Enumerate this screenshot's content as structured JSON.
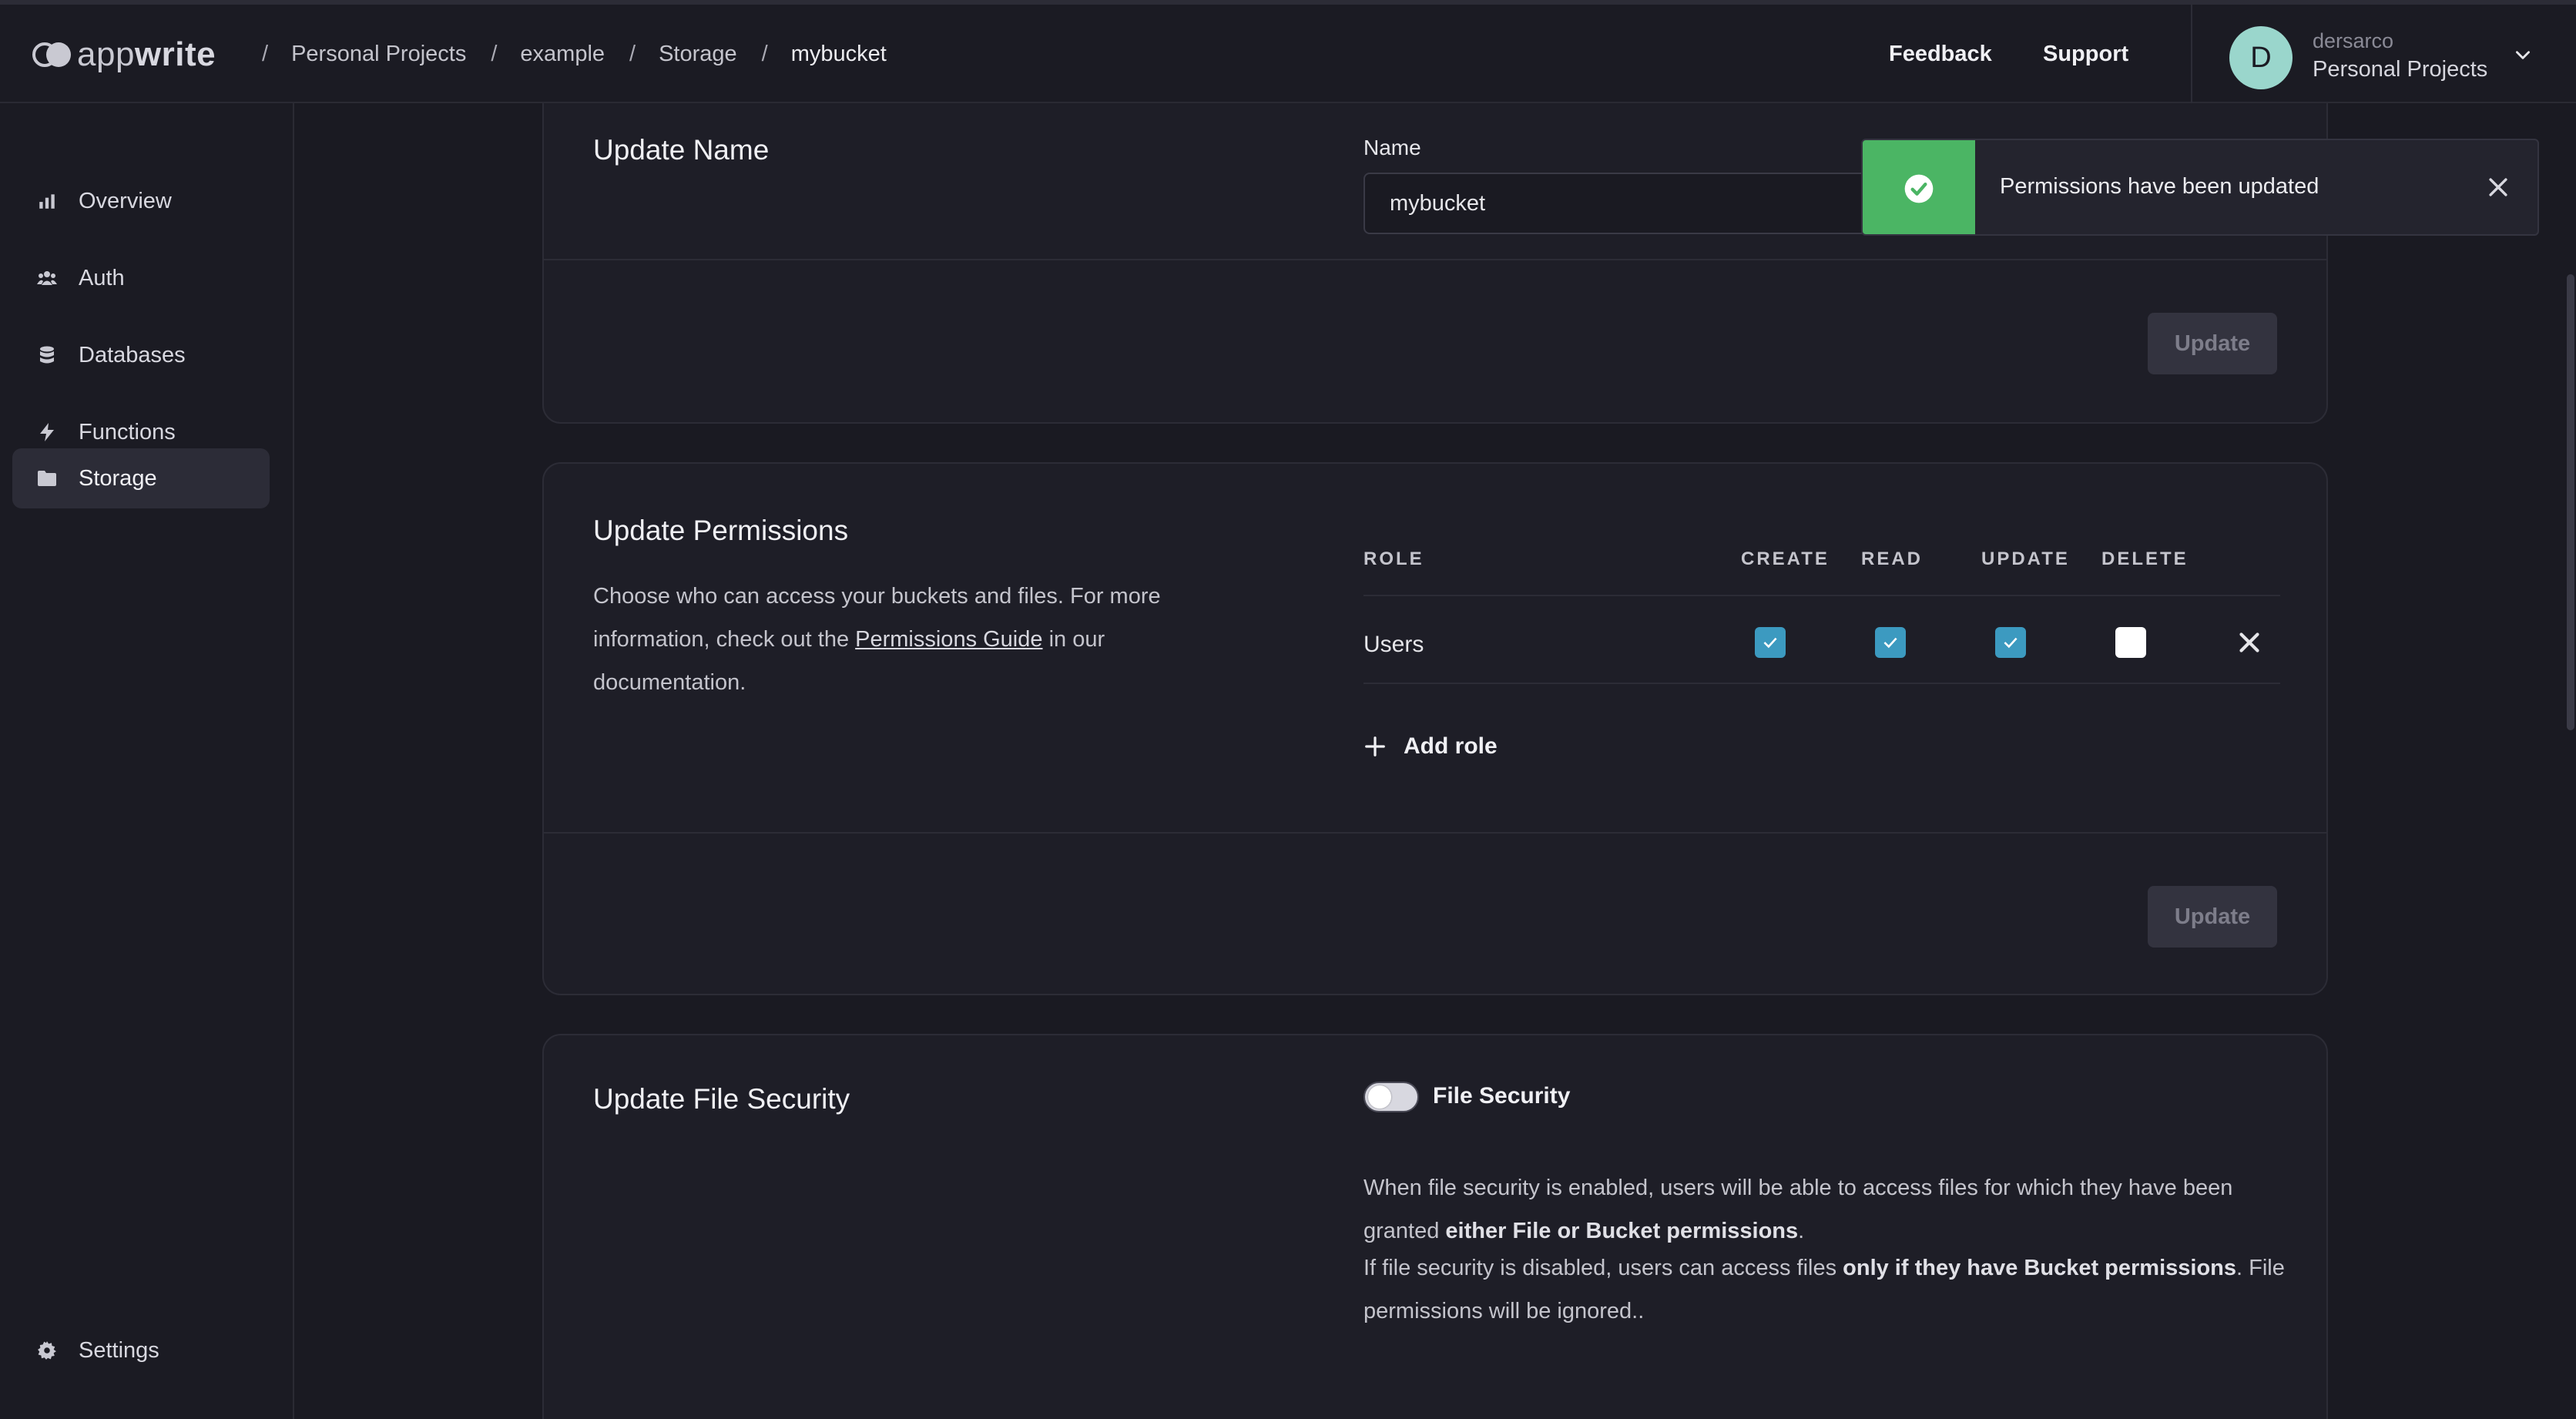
{
  "app": {
    "logo_text_light": "app",
    "logo_text_bold": "write"
  },
  "breadcrumb": [
    "Personal Projects",
    "example",
    "Storage",
    "mybucket"
  ],
  "breadcrumb_sep": "/",
  "header": {
    "feedback_label": "Feedback",
    "support_label": "Support",
    "avatar_initial": "D",
    "username": "dersarco",
    "organization": "Personal Projects"
  },
  "sidebar": {
    "items": [
      {
        "label": "Overview",
        "icon": "chart-icon"
      },
      {
        "label": "Auth",
        "icon": "users-icon"
      },
      {
        "label": "Databases",
        "icon": "database-icon"
      },
      {
        "label": "Functions",
        "icon": "lightning-icon"
      },
      {
        "label": "Storage",
        "icon": "folder-icon",
        "active": true
      }
    ],
    "settings_label": "Settings"
  },
  "update_name": {
    "title": "Update Name",
    "field_label": "Name",
    "value": "mybucket",
    "button": "Update"
  },
  "update_permissions": {
    "title": "Update Permissions",
    "desc_before": "Choose who can access your buckets and files. For more information, check out the ",
    "desc_link": "Permissions Guide",
    "desc_after": " in our documentation.",
    "columns": [
      "ROLE",
      "CREATE",
      "READ",
      "UPDATE",
      "DELETE"
    ],
    "rows": [
      {
        "role": "Users",
        "create": true,
        "read": true,
        "update": true,
        "delete": false
      }
    ],
    "add_role_label": "Add role",
    "button": "Update"
  },
  "update_file_security": {
    "title": "Update File Security",
    "toggle_label": "File Security",
    "toggle_on": false,
    "para1_before": "When file security is enabled, users will be able to access files for which they have been granted ",
    "para1_bold": "either File or Bucket permissions",
    "para1_after": ".",
    "para2_before": "If file security is disabled, users can access files ",
    "para2_bold": "only if they have Bucket permissions",
    "para2_after": ". File permissions will be ignored.."
  },
  "toast": {
    "message": "Permissions have been updated"
  },
  "colors": {
    "accent_checkbox": "#3c9ac0",
    "toast_success": "#4bb564",
    "avatar_bg": "#9ad6cc"
  }
}
